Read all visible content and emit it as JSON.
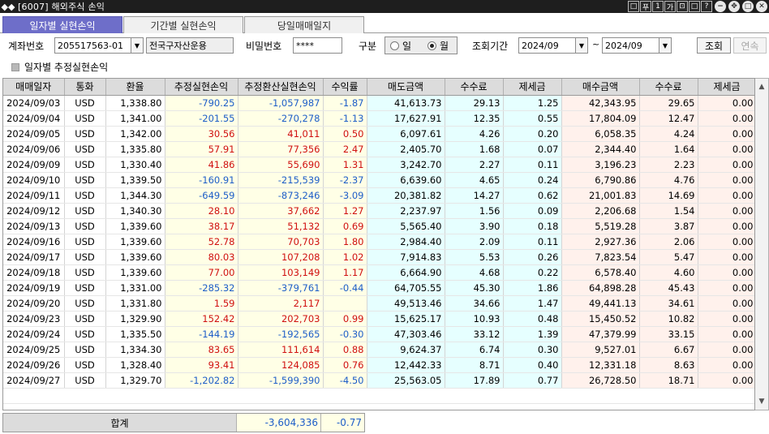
{
  "window": {
    "title": "[6007] 해외주식 손익"
  },
  "tabs": [
    {
      "label": "일자별 실현손익",
      "active": true
    },
    {
      "label": "기간별 실현손익",
      "active": false
    },
    {
      "label": "당일매매일지",
      "active": false
    }
  ],
  "filter": {
    "account_label": "계좌번호",
    "account_value": "205517563-01",
    "account_name": "전국구자산운용",
    "password_label": "비밀번호",
    "password_value": "****",
    "type_label": "구분",
    "type_options": [
      "일",
      "월"
    ],
    "type_selected": "월",
    "period_label": "조회기간",
    "period_from": "2024/09",
    "period_sep": "~",
    "period_to": "2024/09",
    "query_button": "조회",
    "continue_button": "연속"
  },
  "checkbox": {
    "label": "일자별 추정실현손익",
    "checked": false
  },
  "table": {
    "columns": [
      "매매일자",
      "통화",
      "환율",
      "추정실현손익",
      "추정환산실현손익",
      "수익률",
      "매도금액",
      "수수료",
      "제세금",
      "매수금액",
      "수수료",
      "제세금"
    ],
    "rows": [
      [
        "2024/09/03",
        "USD",
        "1,338.80",
        "-790.25",
        "-1,057,987",
        "-1.87",
        "41,613.73",
        "29.13",
        "1.25",
        "42,343.95",
        "29.65",
        "0.00"
      ],
      [
        "2024/09/04",
        "USD",
        "1,341.00",
        "-201.55",
        "-270,278",
        "-1.13",
        "17,627.91",
        "12.35",
        "0.55",
        "17,804.09",
        "12.47",
        "0.00"
      ],
      [
        "2024/09/05",
        "USD",
        "1,342.00",
        "30.56",
        "41,011",
        "0.50",
        "6,097.61",
        "4.26",
        "0.20",
        "6,058.35",
        "4.24",
        "0.00"
      ],
      [
        "2024/09/06",
        "USD",
        "1,335.80",
        "57.91",
        "77,356",
        "2.47",
        "2,405.70",
        "1.68",
        "0.07",
        "2,344.40",
        "1.64",
        "0.00"
      ],
      [
        "2024/09/09",
        "USD",
        "1,330.40",
        "41.86",
        "55,690",
        "1.31",
        "3,242.70",
        "2.27",
        "0.11",
        "3,196.23",
        "2.23",
        "0.00"
      ],
      [
        "2024/09/10",
        "USD",
        "1,339.50",
        "-160.91",
        "-215,539",
        "-2.37",
        "6,639.60",
        "4.65",
        "0.24",
        "6,790.86",
        "4.76",
        "0.00"
      ],
      [
        "2024/09/11",
        "USD",
        "1,344.30",
        "-649.59",
        "-873,246",
        "-3.09",
        "20,381.82",
        "14.27",
        "0.62",
        "21,001.83",
        "14.69",
        "0.00"
      ],
      [
        "2024/09/12",
        "USD",
        "1,340.30",
        "28.10",
        "37,662",
        "1.27",
        "2,237.97",
        "1.56",
        "0.09",
        "2,206.68",
        "1.54",
        "0.00"
      ],
      [
        "2024/09/13",
        "USD",
        "1,339.60",
        "38.17",
        "51,132",
        "0.69",
        "5,565.40",
        "3.90",
        "0.18",
        "5,519.28",
        "3.87",
        "0.00"
      ],
      [
        "2024/09/16",
        "USD",
        "1,339.60",
        "52.78",
        "70,703",
        "1.80",
        "2,984.40",
        "2.09",
        "0.11",
        "2,927.36",
        "2.06",
        "0.00"
      ],
      [
        "2024/09/17",
        "USD",
        "1,339.60",
        "80.03",
        "107,208",
        "1.02",
        "7,914.83",
        "5.53",
        "0.26",
        "7,823.54",
        "5.47",
        "0.00"
      ],
      [
        "2024/09/18",
        "USD",
        "1,339.60",
        "77.00",
        "103,149",
        "1.17",
        "6,664.90",
        "4.68",
        "0.22",
        "6,578.40",
        "4.60",
        "0.00"
      ],
      [
        "2024/09/19",
        "USD",
        "1,331.00",
        "-285.32",
        "-379,761",
        "-0.44",
        "64,705.55",
        "45.30",
        "1.86",
        "64,898.28",
        "45.43",
        "0.00"
      ],
      [
        "2024/09/20",
        "USD",
        "1,331.80",
        "1.59",
        "2,117",
        "",
        "49,513.46",
        "34.66",
        "1.47",
        "49,441.13",
        "34.61",
        "0.00"
      ],
      [
        "2024/09/23",
        "USD",
        "1,329.90",
        "152.42",
        "202,703",
        "0.99",
        "15,625.17",
        "10.93",
        "0.48",
        "15,450.52",
        "10.82",
        "0.00"
      ],
      [
        "2024/09/24",
        "USD",
        "1,335.50",
        "-144.19",
        "-192,565",
        "-0.30",
        "47,303.46",
        "33.12",
        "1.39",
        "47,379.99",
        "33.15",
        "0.00"
      ],
      [
        "2024/09/25",
        "USD",
        "1,334.30",
        "83.65",
        "111,614",
        "0.88",
        "9,624.37",
        "6.74",
        "0.30",
        "9,527.01",
        "6.67",
        "0.00"
      ],
      [
        "2024/09/26",
        "USD",
        "1,328.40",
        "93.41",
        "124,085",
        "0.76",
        "12,442.33",
        "8.71",
        "0.40",
        "12,331.18",
        "8.63",
        "0.00"
      ],
      [
        "2024/09/27",
        "USD",
        "1,329.70",
        "-1,202.82",
        "-1,599,390",
        "-4.50",
        "25,563.05",
        "17.89",
        "0.77",
        "26,728.50",
        "18.71",
        "0.00"
      ]
    ]
  },
  "total": {
    "label": "합계",
    "converted_pnl": "-3,604,336",
    "return_rate": "-0.77"
  },
  "colors": {
    "negative": "#1e5ec8",
    "positive": "#d01010",
    "active_tab": "#6e6ec9"
  },
  "icons": [
    "app-logo-icon",
    "window-control-icons",
    "dropdown-arrow-icon",
    "scroll-up-icon",
    "scroll-down-icon"
  ]
}
